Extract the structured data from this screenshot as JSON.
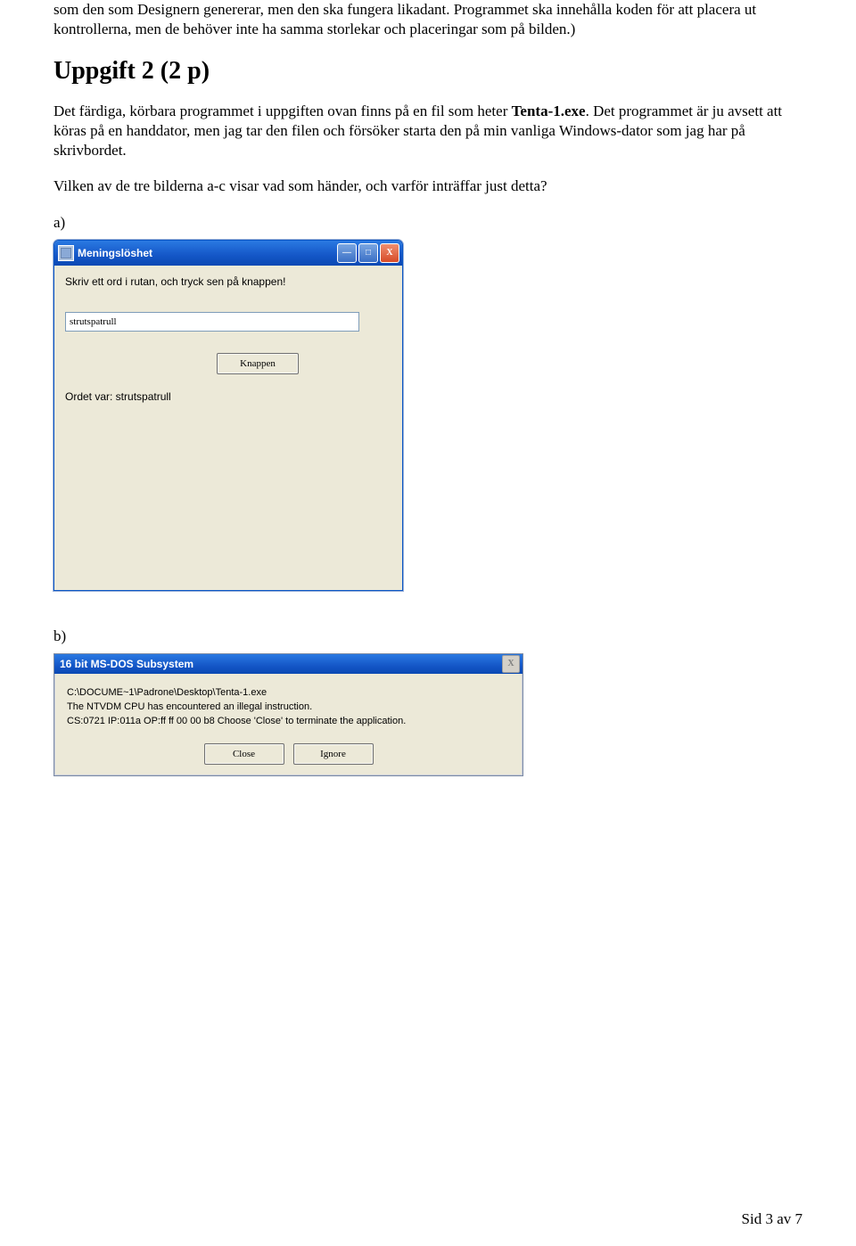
{
  "intro": {
    "p1": "som den som Designern genererar, men den ska fungera likadant. Programmet ska innehålla koden för att placera ut kontrollerna, men de behöver inte ha samma storlekar och placeringar som på bilden.)"
  },
  "heading": "Uppgift 2 (2 p)",
  "para2_part1": "Det färdiga, körbara programmet i uppgiften ovan finns på en fil som heter ",
  "para2_bold": "Tenta-1.exe",
  "para2_part2": ". Det programmet är ju avsett att köras på en handdator, men jag tar den filen och försöker starta den på min vanliga Windows-dator som jag har på skrivbordet.",
  "para3": "Vilken av de tre bilderna a-c visar vad som händer, och varför inträffar just detta?",
  "option_a": "a)",
  "option_b": "b)",
  "xp": {
    "title": "Meningslöshet",
    "min_glyph": "—",
    "max_glyph": "□",
    "close_glyph": "X",
    "instruction": "Skriv ett ord i rutan, och tryck sen på knappen!",
    "input_value": "strutspatrull",
    "button_label": "Knappen",
    "result": "Ordet var: strutspatrull"
  },
  "dos": {
    "title": "16 bit MS-DOS Subsystem",
    "close_glyph": "X",
    "line1": "C:\\DOCUME~1\\Padrone\\Desktop\\Tenta-1.exe",
    "line2": "The NTVDM CPU has encountered an illegal instruction.",
    "line3": "CS:0721 IP:011a OP:ff ff 00 00 b8 Choose 'Close' to terminate the application.",
    "close_btn": "Close",
    "ignore_btn": "Ignore"
  },
  "footer": "Sid 3 av 7"
}
